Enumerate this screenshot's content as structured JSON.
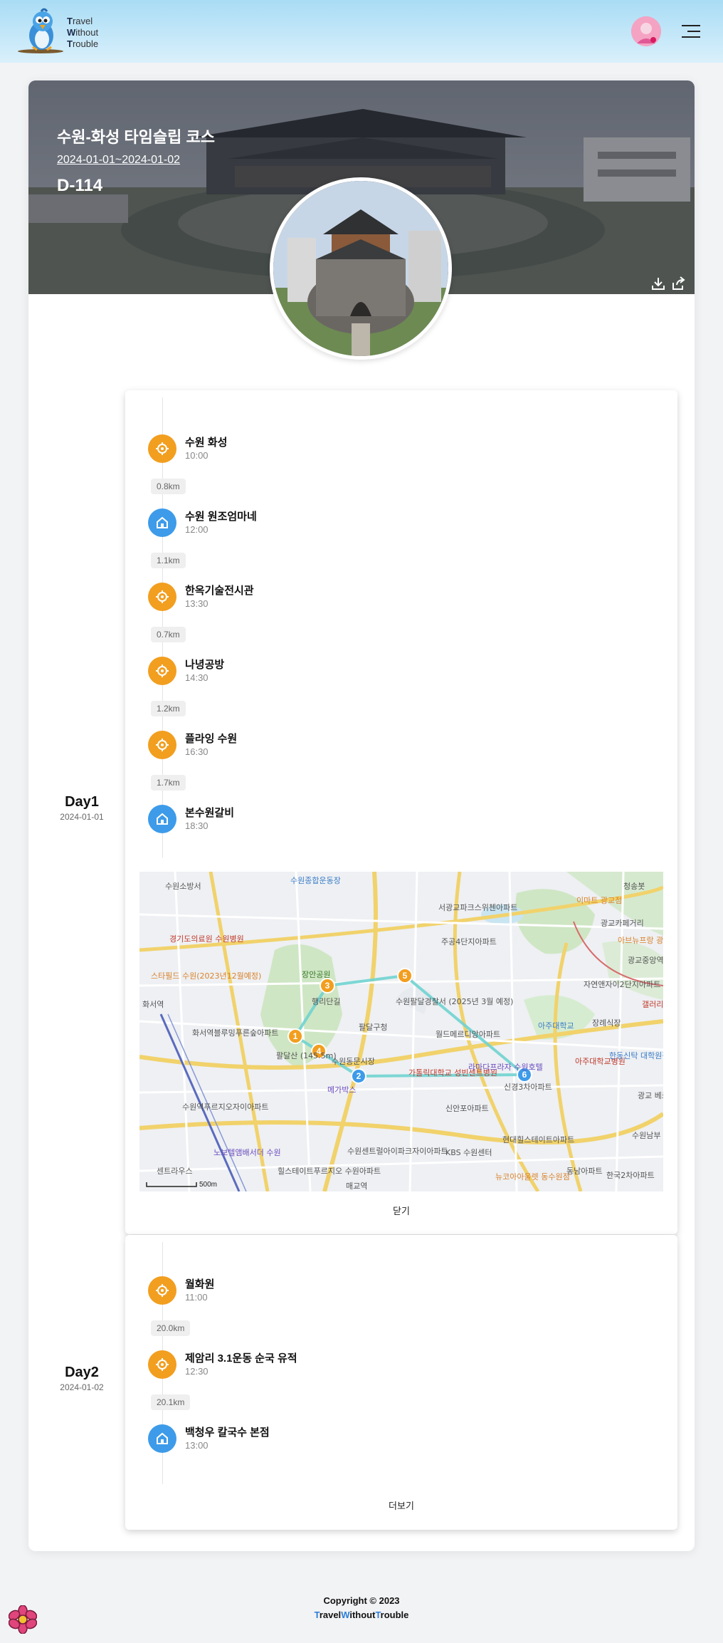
{
  "header": {
    "logo_lines": [
      {
        "first": "T",
        "rest": "ravel"
      },
      {
        "first": "W",
        "rest": "ithout"
      },
      {
        "first": "T",
        "rest": "rouble"
      }
    ]
  },
  "trip": {
    "title": "수원-화성 타임슬립 코스",
    "dates": "2024-01-01~2024-01-02",
    "dday": "D-114"
  },
  "days": [
    {
      "label": "Day1",
      "date": "2024-01-01",
      "stops": [
        {
          "name": "수원 화성",
          "time": "10:00",
          "icon": "attraction-icon"
        },
        {
          "name": "수원 원조엄마네",
          "time": "12:00",
          "icon": "restaurant-icon"
        },
        {
          "name": "한옥기술전시관",
          "time": "13:30",
          "icon": "attraction-icon"
        },
        {
          "name": "나녕공방",
          "time": "14:30",
          "icon": "attraction-icon"
        },
        {
          "name": "플라잉 수원",
          "time": "16:30",
          "icon": "attraction-icon"
        },
        {
          "name": "본수원갈비",
          "time": "18:30",
          "icon": "restaurant-icon"
        }
      ],
      "distances": [
        "0.8km",
        "1.1km",
        "0.7km",
        "1.2km",
        "1.7km"
      ],
      "button": "닫기"
    },
    {
      "label": "Day2",
      "date": "2024-01-02",
      "stops": [
        {
          "name": "월화원",
          "time": "11:00",
          "icon": "attraction-icon"
        },
        {
          "name": "제암리 3.1운동 순국 유적",
          "time": "12:30",
          "icon": "attraction-icon"
        },
        {
          "name": "백청우 칼국수 본점",
          "time": "13:00",
          "icon": "restaurant-icon"
        }
      ],
      "distances": [
        "20.0km",
        "20.1km"
      ],
      "button": "더보기"
    }
  ],
  "map": {
    "scale": "500m",
    "markers": [
      "1",
      "2",
      "3",
      "4",
      "5",
      "6"
    ],
    "place_labels": [
      "수원소방서",
      "수원종합운동장",
      "서광교파크스위첸아파트",
      "경기도의료원 수원병원",
      "주공4단지아파트",
      "광교카페거리",
      "장안공원",
      "행리단길",
      "팔달구청",
      "수원팔달경찰서 (2025년 3월 예정)",
      "월드메르디앙아파트",
      "아주대학교",
      "화서역블루밍푸른숲아파트",
      "팔달산 (145.5m)",
      "수원동문시장",
      "가톨릭대학교 성빈센트병원",
      "라마다프라자 수원호텔",
      "신안포아파트",
      "KBS 수원센터",
      "현대힐스테이트아파트",
      "신경3차아파트",
      "아주대학교병원",
      "자연앤자이2단지아파트",
      "수원역푸르지오자이아파트",
      "노보텔앰배서더 수원",
      "힐스테이트푸르지오 수원아파트",
      "수원센트럴아이파크자이아파트",
      "동남아파트",
      "한국2차아파트",
      "센트라우스",
      "스타필드 수원(2023년12월예정)",
      "메가박스",
      "화서역",
      "장례식장",
      "한동신탁 대학원광교",
      "뉴코아아울렛 동수원점",
      "이마트 광교점",
      "청송봇",
      "아브뉴프랑 광교",
      "광교중앙역",
      "갤러리아 광교",
      "광교 베르디",
      "수원남부 경찰서",
      "매교역"
    ],
    "close_label": "닫기"
  },
  "footer": {
    "copyright": "Copyright © 2023",
    "brand": [
      {
        "first": "T",
        "rest": "ravel"
      },
      {
        "first": "W",
        "rest": "ithout"
      },
      {
        "first": "T",
        "rest": "rouble"
      }
    ]
  },
  "colors": {
    "accent_orange": "#f29e1f",
    "accent_blue": "#3d9be9",
    "route_teal": "#6fd3d0",
    "footer_blue": "#2e7dd7"
  }
}
